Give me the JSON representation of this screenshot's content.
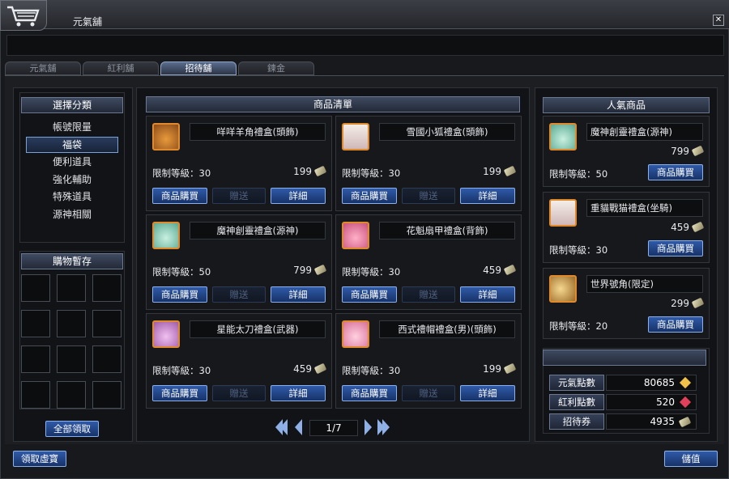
{
  "window": {
    "title": "元氣舖",
    "close_glyph": "✕"
  },
  "tabs": [
    {
      "label": "元氣舖"
    },
    {
      "label": "紅利舖"
    },
    {
      "label": "招待舖"
    },
    {
      "label": "鍊金"
    }
  ],
  "category": {
    "header": "選擇分類",
    "items": [
      "帳號限量",
      "福袋",
      "便利道具",
      "強化輔助",
      "特殊道具",
      "源神相關"
    ]
  },
  "cart": {
    "header": "購物暫存",
    "collect_all": "全部領取"
  },
  "main": {
    "header": "商品清單"
  },
  "products": [
    {
      "name": "咩咩羊角禮盒(頭飾)",
      "level_label": "限制等級：30",
      "price": "199"
    },
    {
      "name": "雪國小狐禮盒(頭飾)",
      "level_label": "限制等級：30",
      "price": "199"
    },
    {
      "name": "魔神創靈禮盒(源神)",
      "level_label": "限制等級：50",
      "price": "799"
    },
    {
      "name": "花魁扇甲禮盒(背飾)",
      "level_label": "限制等級：30",
      "price": "459"
    },
    {
      "name": "星能太刀禮盒(武器)",
      "level_label": "限制等級：30",
      "price": "459"
    },
    {
      "name": "西式禮帽禮盒(男)(頭飾)",
      "level_label": "限制等級：30",
      "price": "199"
    }
  ],
  "buttons": {
    "buy": "商品購買",
    "gift": "贈送",
    "detail": "詳細"
  },
  "pagination": {
    "page": "1/7"
  },
  "popular": {
    "header": "人氣商品",
    "items": [
      {
        "name": "魔神創靈禮盒(源神)",
        "price": "799",
        "level_label": "限制等級：50"
      },
      {
        "name": "重貓戰猫禮盒(坐騎)",
        "price": "459",
        "level_label": "限制等級：30"
      },
      {
        "name": "世界號角(限定)",
        "price": "299",
        "level_label": "限制等級：20"
      }
    ]
  },
  "currency": [
    {
      "label": "元氣點數",
      "value": "80685",
      "color": "#f2c14a"
    },
    {
      "label": "紅利點數",
      "value": "520",
      "color": "#e0405a"
    },
    {
      "label": "招待券",
      "value": "4935",
      "color": "#c9c39a"
    }
  ],
  "footer": {
    "receive": "領取虛寶",
    "recharge": "儲值"
  }
}
